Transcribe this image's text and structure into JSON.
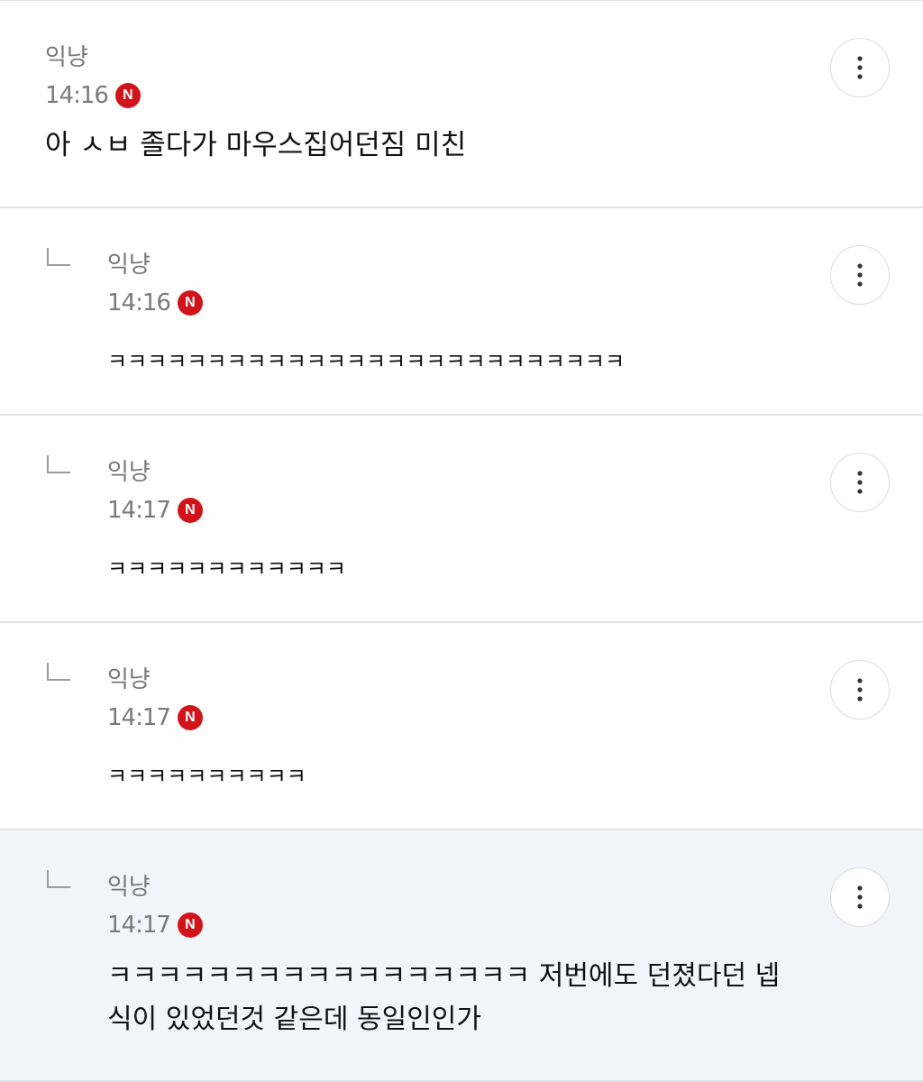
{
  "comments": [
    {
      "author": "익냥",
      "time": "14:16",
      "badge": "N",
      "text": "아 ㅅㅂ 졸다가 마우스집어던짐 미친",
      "is_reply": false
    },
    {
      "author": "익냥",
      "time": "14:16",
      "badge": "N",
      "text": "ㅋㅋㅋㅋㅋㅋㅋㅋㅋㅋㅋㅋㅋㅋㅋㅋㅋㅋㅋㅋㅋㅋㅋㅋㅋㅋ",
      "is_reply": true
    },
    {
      "author": "익냥",
      "time": "14:17",
      "badge": "N",
      "text": "ㅋㅋㅋㅋㅋㅋㅋㅋㅋㅋㅋㅋ",
      "is_reply": true
    },
    {
      "author": "익냥",
      "time": "14:17",
      "badge": "N",
      "text": "ㅋㅋㅋㅋㅋㅋㅋㅋㅋㅋ",
      "is_reply": true
    },
    {
      "author": "익냥",
      "time": "14:17",
      "badge": "N",
      "text": "ㅋㅋㅋㅋㅋㅋㅋㅋㅋㅋㅋㅋㅋㅋㅋㅋㅋ 저번에도 던졌다던 넵식이 있었던것 같은데 동일인인가",
      "is_reply": true,
      "highlighted": true
    }
  ],
  "colors": {
    "new_badge": "#d0141a",
    "highlight_bg": "#f2f6fa",
    "meta_text": "#777777"
  },
  "icons": {
    "more": "more-vertical-icon",
    "reply": "reply-arrow-icon"
  }
}
